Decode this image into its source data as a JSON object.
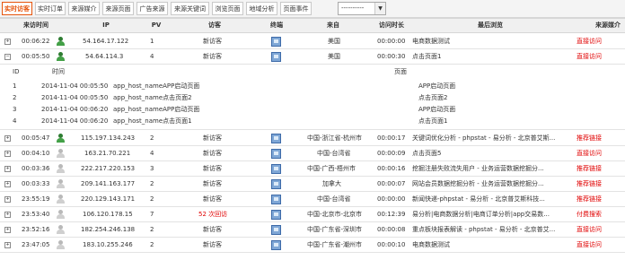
{
  "tabs": [
    "实时访客",
    "实时订单",
    "来源媒介",
    "来源页面",
    "广告来源",
    "来源关键词",
    "浏览页面",
    "地域分析",
    "页面事件"
  ],
  "filter_select": {
    "value": "----------"
  },
  "columns": [
    "来访时间",
    "IP",
    "PV",
    "访客",
    "终端",
    "来自",
    "访问时长",
    "最后浏览",
    "来源媒介"
  ],
  "rows": [
    {
      "toggle": "+",
      "time": "00:06:22",
      "avatar": "green",
      "ip": "54.164.17.122",
      "pv": "1",
      "visitor": "新访客",
      "from": "美国",
      "duration": "00:00:00",
      "last": "电商数据测试",
      "source": "直接访问",
      "source_color": "red"
    },
    {
      "toggle": "−",
      "time": "00:05:50",
      "avatar": "green",
      "ip": "54.64.114.3",
      "pv": "4",
      "visitor": "新访客",
      "from": "美国",
      "duration": "00:00:30",
      "last": "点击页面1",
      "source": "直接访问",
      "source_color": "red"
    }
  ],
  "detail": {
    "headers": {
      "id": "ID",
      "time": "时间",
      "page": "页面"
    },
    "rows": [
      {
        "id": "1",
        "time": "2014-11-04 00:05:50",
        "event": "app_host_nameAPP启动页面",
        "page": "APP启动页面"
      },
      {
        "id": "2",
        "time": "2014-11-04 00:05:50",
        "event": "app_host_name点击页面2",
        "page": "点击页面2"
      },
      {
        "id": "3",
        "time": "2014-11-04 00:06:20",
        "event": "app_host_nameAPP启动页面",
        "page": "APP启动页面"
      },
      {
        "id": "4",
        "time": "2014-11-04 00:06:20",
        "event": "app_host_name点击页面1",
        "page": "点击页面1"
      }
    ]
  },
  "rows2": [
    {
      "toggle": "+",
      "time": "00:05:47",
      "avatar": "green",
      "ip": "115.197.134.243",
      "pv": "2",
      "visitor": "新访客",
      "from": "中国-浙江省-杭州市",
      "duration": "00:00:17",
      "last": "关键词优化分析 - phpstat - 易分析 - 北京普艾斯...",
      "source": "推荐链接",
      "source_color": "red"
    },
    {
      "toggle": "+",
      "time": "00:04:10",
      "avatar": "gray",
      "ip": "163.21.70.221",
      "pv": "4",
      "visitor": "新访客",
      "from": "中国-台湾省",
      "duration": "00:00:09",
      "last": "点击页面5",
      "source": "直接访问",
      "source_color": "red"
    },
    {
      "toggle": "+",
      "time": "00:03:36",
      "avatar": "gray",
      "ip": "222.217.220.153",
      "pv": "3",
      "visitor": "新访客",
      "from": "中国-广西-梧州市",
      "duration": "00:00:16",
      "last": "挖掘注册失败流失用户 - 业务运营数据挖掘分...",
      "source": "推荐链接",
      "source_color": "red"
    },
    {
      "toggle": "+",
      "time": "00:03:33",
      "avatar": "gray",
      "ip": "209.141.163.177",
      "pv": "2",
      "visitor": "新访客",
      "from": "加拿大",
      "duration": "00:00:07",
      "last": "网站会员数据挖掘分析 - 业务运营数据挖掘分...",
      "source": "推荐链接",
      "source_color": "red"
    },
    {
      "toggle": "+",
      "time": "23:55:19",
      "avatar": "gray",
      "ip": "220.129.143.171",
      "pv": "2",
      "visitor": "新访客",
      "from": "中国-台湾省",
      "duration": "00:00:00",
      "last": "新闻快递-phpstat - 易分析 - 北京普艾斯科技...",
      "source": "推荐链接",
      "source_color": "red"
    },
    {
      "toggle": "+",
      "time": "23:53:40",
      "avatar": "gray",
      "ip": "106.120.178.15",
      "pv": "7",
      "visitor": "52 次回访",
      "visitor_red": true,
      "from": "中国-北京市-北京市",
      "duration": "00:12:39",
      "last": "易分析|电商数据分析|电商订单分析|app交易数...",
      "source": "付费搜索",
      "source_color": "red"
    },
    {
      "toggle": "+",
      "time": "23:52:16",
      "avatar": "gray",
      "ip": "182.254.246.138",
      "pv": "2",
      "visitor": "新访客",
      "from": "中国-广东省-深圳市",
      "duration": "00:00:08",
      "last": "重点板块报表解读 - phpstat - 易分析 - 北京普艾...",
      "source": "直接访问",
      "source_color": "red"
    },
    {
      "toggle": "+",
      "time": "23:47:05",
      "avatar": "gray",
      "ip": "183.10.255.246",
      "pv": "2",
      "visitor": "新访客",
      "from": "中国-广东省-潮州市",
      "duration": "00:00:10",
      "last": "电商数据测试",
      "source": "直接访问",
      "source_color": "red"
    }
  ]
}
